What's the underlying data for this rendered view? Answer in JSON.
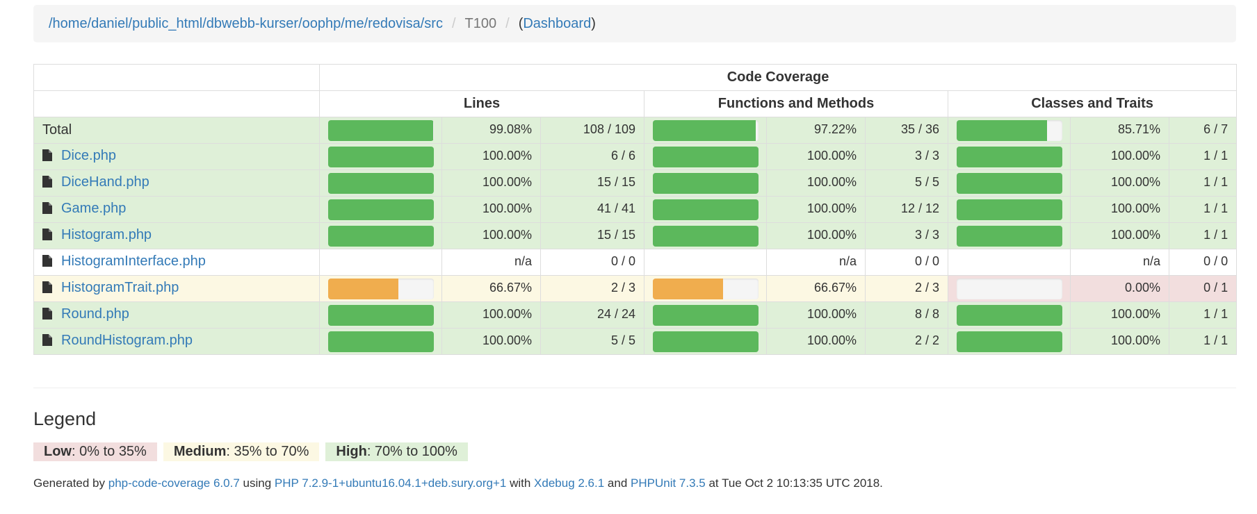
{
  "breadcrumb": {
    "path": "/home/daniel/public_html/dbwebb-kurser/oophp/me/redovisa/src",
    "current": "T100",
    "dashboard": "Dashboard",
    "open_paren": "(",
    "close_paren": ")",
    "separator": "/"
  },
  "table": {
    "header_code_coverage": "Code Coverage",
    "header_lines": "Lines",
    "header_functions": "Functions and Methods",
    "header_classes": "Classes and Traits",
    "rows": [
      {
        "name": "Total",
        "is_file": false,
        "status": "success",
        "lines": {
          "percent": "99.08%",
          "ratio": "108 / 109",
          "bar": 0.9908,
          "level": "success"
        },
        "functions": {
          "percent": "97.22%",
          "ratio": "35 / 36",
          "bar": 0.9722,
          "level": "success"
        },
        "classes": {
          "percent": "85.71%",
          "ratio": "6 / 7",
          "bar": 0.8571,
          "level": "success"
        }
      },
      {
        "name": "Dice.php",
        "is_file": true,
        "status": "success",
        "lines": {
          "percent": "100.00%",
          "ratio": "6 / 6",
          "bar": 1,
          "level": "success"
        },
        "functions": {
          "percent": "100.00%",
          "ratio": "3 / 3",
          "bar": 1,
          "level": "success"
        },
        "classes": {
          "percent": "100.00%",
          "ratio": "1 / 1",
          "bar": 1,
          "level": "success"
        }
      },
      {
        "name": "DiceHand.php",
        "is_file": true,
        "status": "success",
        "lines": {
          "percent": "100.00%",
          "ratio": "15 / 15",
          "bar": 1,
          "level": "success"
        },
        "functions": {
          "percent": "100.00%",
          "ratio": "5 / 5",
          "bar": 1,
          "level": "success"
        },
        "classes": {
          "percent": "100.00%",
          "ratio": "1 / 1",
          "bar": 1,
          "level": "success"
        }
      },
      {
        "name": "Game.php",
        "is_file": true,
        "status": "success",
        "lines": {
          "percent": "100.00%",
          "ratio": "41 / 41",
          "bar": 1,
          "level": "success"
        },
        "functions": {
          "percent": "100.00%",
          "ratio": "12 / 12",
          "bar": 1,
          "level": "success"
        },
        "classes": {
          "percent": "100.00%",
          "ratio": "1 / 1",
          "bar": 1,
          "level": "success"
        }
      },
      {
        "name": "Histogram.php",
        "is_file": true,
        "status": "success",
        "lines": {
          "percent": "100.00%",
          "ratio": "15 / 15",
          "bar": 1,
          "level": "success"
        },
        "functions": {
          "percent": "100.00%",
          "ratio": "3 / 3",
          "bar": 1,
          "level": "success"
        },
        "classes": {
          "percent": "100.00%",
          "ratio": "1 / 1",
          "bar": 1,
          "level": "success"
        }
      },
      {
        "name": "HistogramInterface.php",
        "is_file": true,
        "status": "none",
        "lines": {
          "percent": "n/a",
          "ratio": "0 / 0",
          "bar": null,
          "level": "none"
        },
        "functions": {
          "percent": "n/a",
          "ratio": "0 / 0",
          "bar": null,
          "level": "none"
        },
        "classes": {
          "percent": "n/a",
          "ratio": "0 / 0",
          "bar": null,
          "level": "none"
        }
      },
      {
        "name": "HistogramTrait.php",
        "is_file": true,
        "status": "warning",
        "lines": {
          "percent": "66.67%",
          "ratio": "2 / 3",
          "bar": 0.6667,
          "level": "warning"
        },
        "functions": {
          "percent": "66.67%",
          "ratio": "2 / 3",
          "bar": 0.6667,
          "level": "warning"
        },
        "classes": {
          "percent": "0.00%",
          "ratio": "0 / 1",
          "bar": 0,
          "level": "danger"
        }
      },
      {
        "name": "Round.php",
        "is_file": true,
        "status": "success",
        "lines": {
          "percent": "100.00%",
          "ratio": "24 / 24",
          "bar": 1,
          "level": "success"
        },
        "functions": {
          "percent": "100.00%",
          "ratio": "8 / 8",
          "bar": 1,
          "level": "success"
        },
        "classes": {
          "percent": "100.00%",
          "ratio": "1 / 1",
          "bar": 1,
          "level": "success"
        }
      },
      {
        "name": "RoundHistogram.php",
        "is_file": true,
        "status": "success",
        "lines": {
          "percent": "100.00%",
          "ratio": "5 / 5",
          "bar": 1,
          "level": "success"
        },
        "functions": {
          "percent": "100.00%",
          "ratio": "2 / 2",
          "bar": 1,
          "level": "success"
        },
        "classes": {
          "percent": "100.00%",
          "ratio": "1 / 1",
          "bar": 1,
          "level": "success"
        }
      }
    ]
  },
  "legend": {
    "title": "Legend",
    "low_label": "Low",
    "low_range": ": 0% to 35%",
    "medium_label": "Medium",
    "medium_range": ": 35% to 70%",
    "high_label": "High",
    "high_range": ": 70% to 100%"
  },
  "footer": {
    "generated_by": "Generated by ",
    "tool_link": "php-code-coverage 6.0.7",
    "using": " using ",
    "php_link": "PHP 7.2.9-1+ubuntu16.04.1+deb.sury.org+1",
    "with": " with ",
    "xdebug_link": "Xdebug 2.6.1",
    "and": " and ",
    "phpunit_link": "PHPUnit 7.3.5",
    "at": " at Tue Oct 2 10:13:35 UTC 2018."
  },
  "colors": {
    "success_bg": "#dff0d8",
    "warning_bg": "#fcf8e3",
    "danger_bg": "#f2dede",
    "bar_success": "#5cb85c",
    "bar_warning": "#f0ad4e",
    "link": "#337ab7"
  }
}
